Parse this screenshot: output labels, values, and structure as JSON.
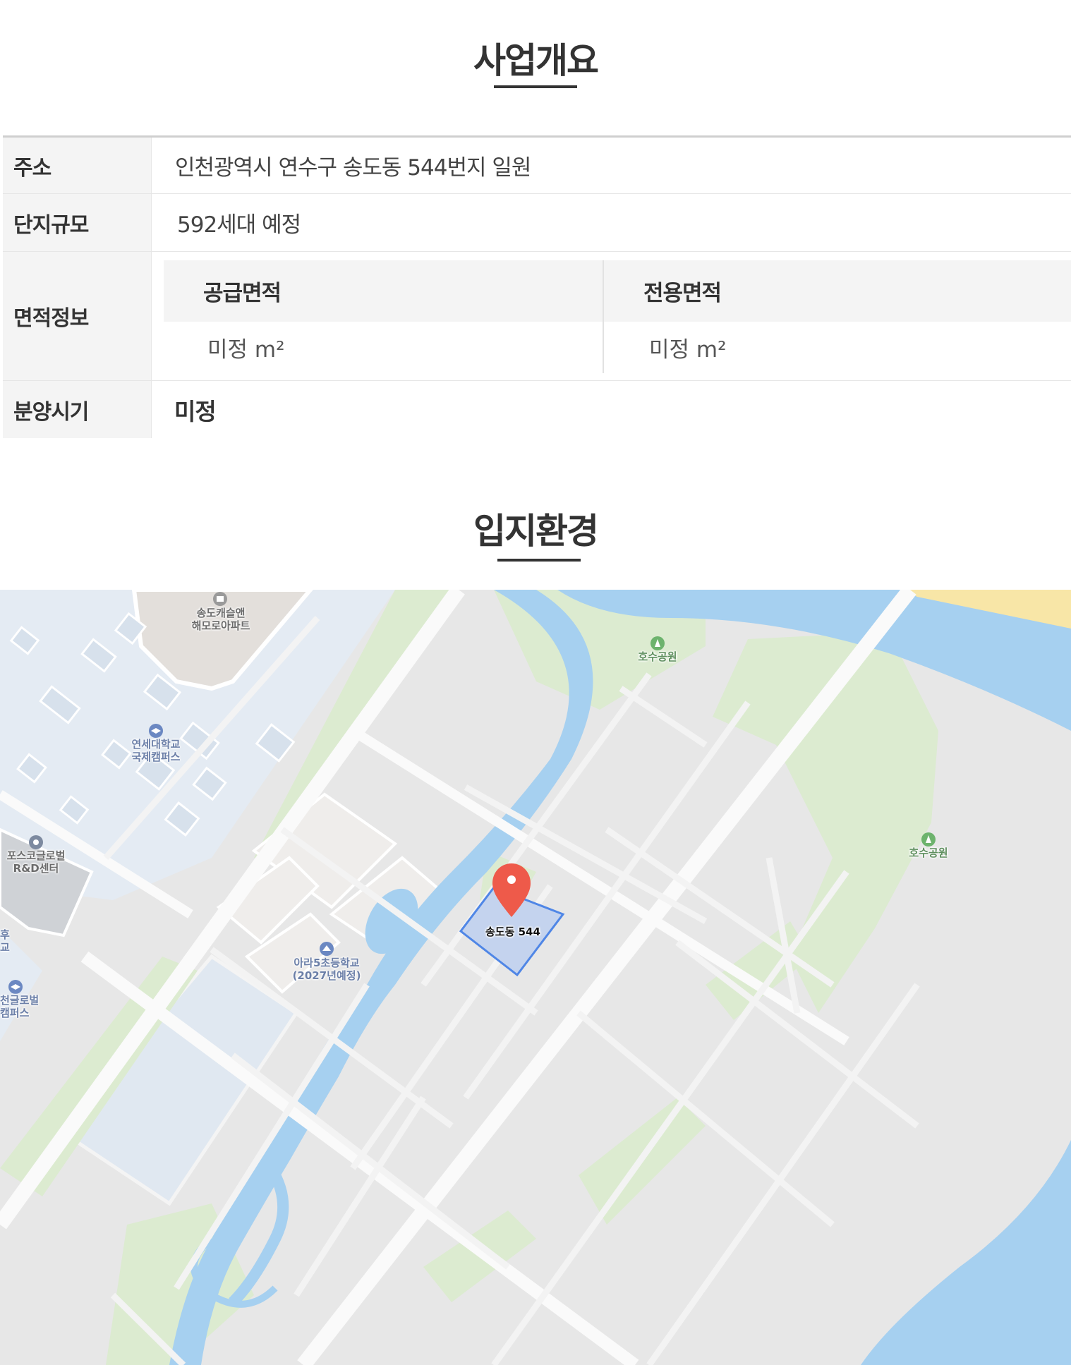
{
  "overview": {
    "title": "사업개요",
    "rows": {
      "address": {
        "label": "주소",
        "value": "인천광역시 연수구 송도동 544번지 일원"
      },
      "scale": {
        "label": "단지규모",
        "value": "592세대 예정"
      },
      "area": {
        "label": "면적정보",
        "supply_header": "공급면적",
        "exclusive_header": "전용면적",
        "supply_value": "미정 m²",
        "exclusive_value": "미정 m²"
      },
      "sale": {
        "label": "분양시기",
        "value": "미정"
      }
    }
  },
  "location": {
    "title": "입지환경",
    "map": {
      "labels": {
        "songdo_castle_1": "송도캐슬앤",
        "songdo_castle_2": "해모로아파트",
        "yonsei_1": "연세대학교",
        "yonsei_2": "국제캠퍼스",
        "posco_1": "포스코글로벌",
        "posco_2": "R&D센터",
        "ara_school_1": "아라5초등학교",
        "ara_school_2": "(2027년예정)",
        "incheon_global_1": "천글로벌",
        "incheon_global_2": "캠퍼스",
        "edge_1": "후",
        "edge_2": "교",
        "lake_park_1": "호수공원",
        "lake_park_2": "호수공원"
      },
      "pin_label": "송도동 544",
      "colors": {
        "water": "#a6d0f0",
        "park": "#dcebd0",
        "campus": "#e4ebf3",
        "land": "#e7e7e7",
        "road": "#f7f7f7",
        "pin": "#ee5a4a",
        "parcel_fill": "#c4d3ee",
        "parcel_stroke": "#4f86e6",
        "beach": "#f8e6a7"
      }
    }
  }
}
